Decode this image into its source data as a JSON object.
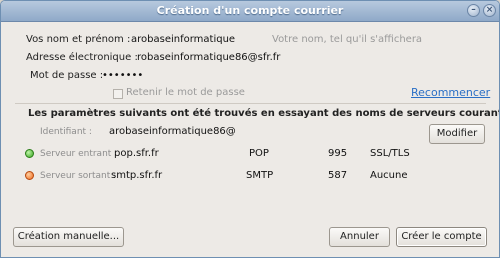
{
  "window": {
    "title": "Création d'un compte courrier",
    "close_glyph": "×",
    "minimize_glyph": "–"
  },
  "form": {
    "name_label": "Vos nom et prénom :",
    "name_value": "arobaseinformatique",
    "name_hint": "Votre nom, tel qu'il s'affichera",
    "email_label": "Adresse électronique :",
    "email_value": "robaseinformatique86@sfr.fr",
    "password_label": "Mot de passe :",
    "password_value": "•••••••",
    "remember_label": "Retenir le mot de passe",
    "recommencer_link": "Recommencer"
  },
  "servers": {
    "found_message": "Les paramètres suivants ont été trouvés en essayant des noms de serveurs courants",
    "identifier_label": "Identifiant :",
    "identifier_value": "arobaseinformatique86@",
    "modify_button": "Modifier",
    "incoming": {
      "label": "Serveur entrant :",
      "host": "pop.sfr.fr",
      "protocol": "POP",
      "port": "995",
      "security": "SSL/TLS",
      "status_color": "#37a51f"
    },
    "outgoing": {
      "label": "Serveur sortant :",
      "host": "smtp.sfr.fr",
      "protocol": "SMTP",
      "port": "587",
      "security": "Aucune",
      "status_color": "#ee6a1e"
    }
  },
  "footer": {
    "manual_button": "Création manuelle...",
    "cancel_button": "Annuler",
    "create_button": "Créer le compte"
  }
}
